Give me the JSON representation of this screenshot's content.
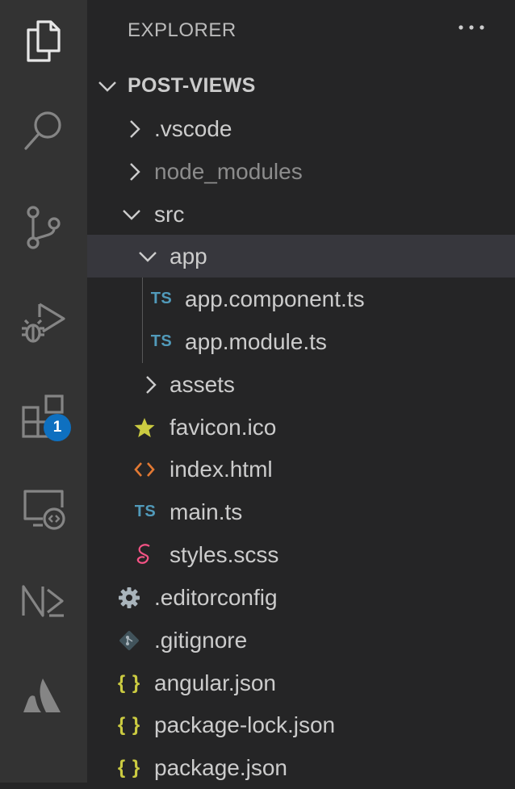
{
  "activity_bar": {
    "items": [
      {
        "name": "explorer",
        "icon": "files-icon"
      },
      {
        "name": "search",
        "icon": "search-icon"
      },
      {
        "name": "source-control",
        "icon": "source-control-icon"
      },
      {
        "name": "run-and-debug",
        "icon": "run-debug-icon"
      },
      {
        "name": "extensions",
        "icon": "extensions-icon",
        "badge": "1"
      },
      {
        "name": "remote-explorer",
        "icon": "remote-explorer-icon"
      },
      {
        "name": "nx-console",
        "icon": "nx-icon"
      },
      {
        "name": "atlassian",
        "icon": "atlassian-icon"
      }
    ],
    "badge_color": "#0e70c0"
  },
  "sidebar": {
    "title": "EXPLORER",
    "more_actions": "···"
  },
  "tree": {
    "root": "POST-VIEWS",
    "items": [
      {
        "label": ".vscode",
        "icon": "chevron-right-icon"
      },
      {
        "label": "node_modules",
        "icon": "chevron-right-icon"
      },
      {
        "label": "src",
        "icon": "chevron-down-icon"
      },
      {
        "label": "app",
        "icon": "chevron-down-icon"
      },
      {
        "label": "app.component.ts",
        "icon": "ts-file-icon",
        "icon_text": "TS"
      },
      {
        "label": "app.module.ts",
        "icon": "ts-file-icon",
        "icon_text": "TS"
      },
      {
        "label": "assets",
        "icon": "chevron-right-icon"
      },
      {
        "label": "favicon.ico",
        "icon": "star-icon"
      },
      {
        "label": "index.html",
        "icon": "html-file-icon"
      },
      {
        "label": "main.ts",
        "icon": "ts-file-icon",
        "icon_text": "TS"
      },
      {
        "label": "styles.scss",
        "icon": "scss-file-icon"
      },
      {
        "label": ".editorconfig",
        "icon": "gear-icon"
      },
      {
        "label": ".gitignore",
        "icon": "git-icon"
      },
      {
        "label": "angular.json",
        "icon": "json-file-icon",
        "icon_text": "{ }"
      },
      {
        "label": "package-lock.json",
        "icon": "json-file-icon",
        "icon_text": "{ }"
      },
      {
        "label": "package.json",
        "icon": "json-file-icon",
        "icon_text": "{ }"
      }
    ]
  },
  "colors": {
    "sidebar_bg": "#252526",
    "activity_bar_bg": "#333333",
    "selected_row_bg": "#37373d",
    "ts_icon": "#519aba",
    "json_icon": "#cbcb41",
    "html_icon": "#e37933",
    "scss_icon": "#f55385",
    "star_icon": "#cbcb41"
  }
}
